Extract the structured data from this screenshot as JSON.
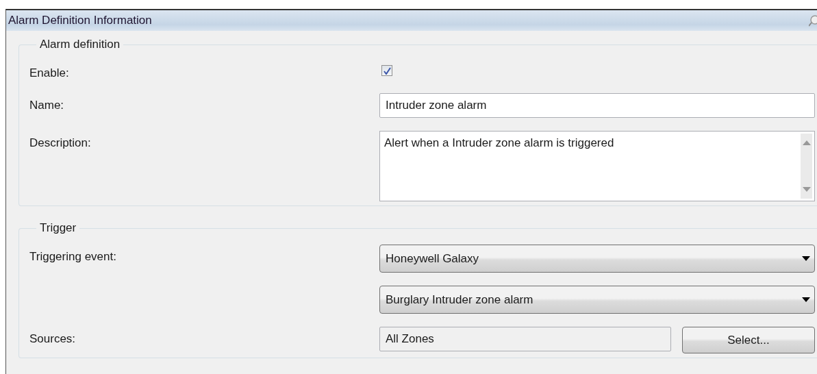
{
  "window": {
    "title": "Alarm Definition Information"
  },
  "groups": [
    {
      "title": "Alarm definition",
      "rows": [
        {
          "kind": "checkbox",
          "label": "Enable:",
          "checked": true
        },
        {
          "kind": "text",
          "label": "Name:",
          "value": "Intruder zone alarm"
        },
        {
          "kind": "textarea",
          "label": "Description:",
          "value": "Alert when a Intruder zone alarm is triggered"
        }
      ]
    },
    {
      "title": "Trigger",
      "rows": [
        {
          "kind": "dropdown",
          "label": "Triggering event:",
          "value": "Honeywell Galaxy"
        },
        {
          "kind": "dropdown",
          "value": "Burglary Intruder zone alarm"
        },
        {
          "kind": "picker",
          "label": "Sources:",
          "value": "All Zones",
          "button": "Select..."
        }
      ]
    }
  ]
}
